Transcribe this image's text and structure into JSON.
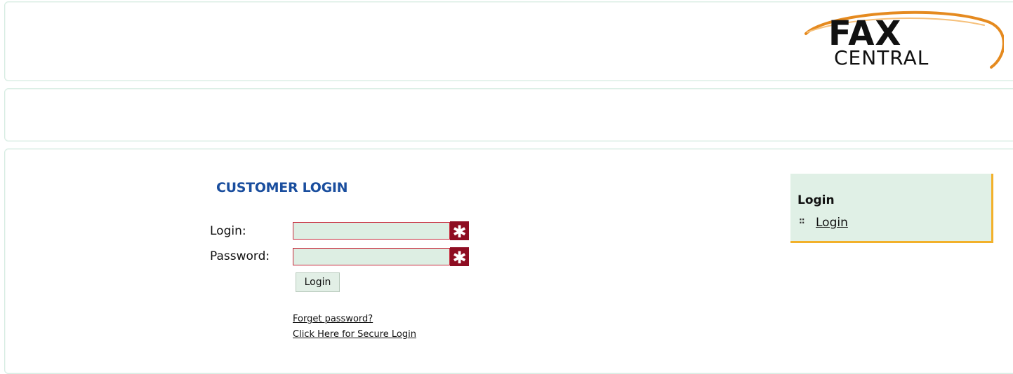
{
  "brand": {
    "logo_line1": "FAX",
    "logo_line2": "CENTRAL",
    "swoosh_color": "#e58a1f"
  },
  "login_form": {
    "title": "CUSTOMER LOGIN",
    "login_label": "Login:",
    "password_label": "Password:",
    "login_value": "",
    "password_value": "",
    "required_marker": "✱",
    "submit_label": "Login",
    "forgot_link": "Forget password?",
    "secure_link": "Click Here for Secure Login"
  },
  "sidebar": {
    "title": "Login",
    "bullet_icon": "grip-dots-icon",
    "link_label": "Login"
  },
  "colors": {
    "title_blue": "#1a4e9e",
    "field_border": "#c8283a",
    "required_bg": "#8e0d22",
    "sidebar_bg": "#e0f0e6",
    "sidebar_accent": "#f2b12b"
  }
}
